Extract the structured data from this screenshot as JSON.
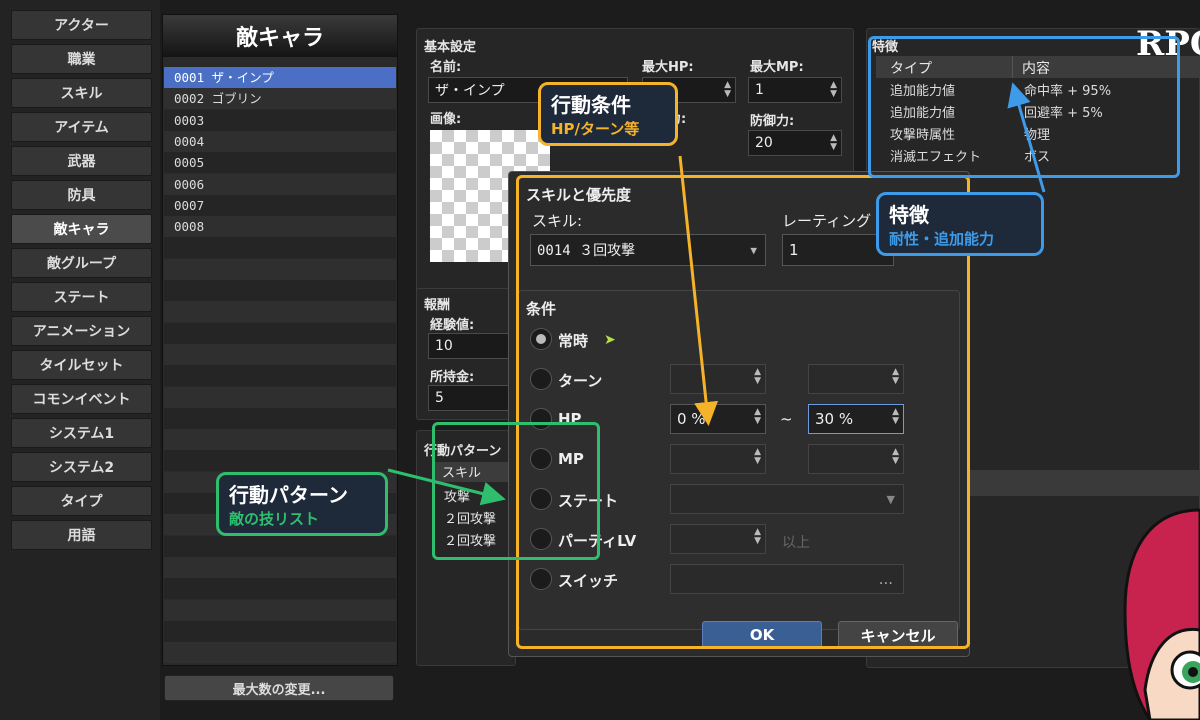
{
  "nav": {
    "items": [
      "アクター",
      "職業",
      "スキル",
      "アイテム",
      "武器",
      "防具",
      "敵キャラ",
      "敵グループ",
      "ステート",
      "アニメーション",
      "タイルセット",
      "コモンイベント",
      "システム1",
      "システム2",
      "タイプ",
      "用語"
    ],
    "active_index": 6
  },
  "enemy_list": {
    "title": "敵キャラ",
    "rows": [
      "0001 ザ・インプ",
      "0002 ゴブリン",
      "0003",
      "0004",
      "0005",
      "0006",
      "0007",
      "0008"
    ],
    "selected_index": 0,
    "max_button": "最大数の変更..."
  },
  "basic": {
    "section_label": "基本設定",
    "name_label": "名前:",
    "name_value": "ザ・インプ",
    "maxhp_label": "最大HP:",
    "maxmp_label": "最大MP:",
    "maxmp_value": "1",
    "image_label": "画像:",
    "def_label": "防御力:",
    "def_value": "20",
    "atk_label_partial": "攻撃力:"
  },
  "reward": {
    "section_label": "報酬",
    "exp_label": "経験値:",
    "exp_value": "10",
    "gold_label": "所持金:",
    "gold_value": "5"
  },
  "action_pattern": {
    "section_label": "行動パターン",
    "col_skill": "スキル",
    "rows": [
      "攻撃",
      "２回攻撃",
      "２回攻撃"
    ]
  },
  "traits": {
    "section_label": "特徴",
    "col_type": "タイプ",
    "col_content": "内容",
    "rows": [
      {
        "type": "追加能力値",
        "content": "命中率 + 95%"
      },
      {
        "type": "追加能力値",
        "content": "回避率 + 5%"
      },
      {
        "type": "攻撃時属性",
        "content": "物理"
      },
      {
        "type": "消滅エフェクト",
        "content": "ボス"
      }
    ]
  },
  "logo_text": "RPG",
  "dialog": {
    "title": "スキルと優先度",
    "skill_label": "スキル:",
    "skill_value": "0014 ３回攻撃",
    "rating_label": "レーティング",
    "rating_value": "1",
    "conditions_label": "条件",
    "conditions": [
      {
        "label": "常時",
        "enabled": true
      },
      {
        "label": "ターン",
        "enabled": true
      },
      {
        "label": "HP",
        "enabled": true,
        "from": "0 %",
        "to": "30 %",
        "tilde": "~"
      },
      {
        "label": "MP",
        "enabled": true
      },
      {
        "label": "ステート",
        "enabled": true
      },
      {
        "label": "パーティLV",
        "enabled": true,
        "suffix": "以上"
      },
      {
        "label": "スイッチ",
        "enabled": true,
        "value": "..."
      }
    ],
    "ok": "OK",
    "cancel": "キャンセル"
  },
  "annotations": {
    "action_condition": {
      "title": "行動条件",
      "sub": "HP/ターン等",
      "color": "#f5b32a"
    },
    "traits_note": {
      "title": "特徴",
      "sub": "耐性・追加能力",
      "color": "#3d9be9"
    },
    "pattern_note": {
      "title": "行動パターン",
      "sub": "敵の技リスト",
      "color": "#2fbe6e"
    }
  }
}
